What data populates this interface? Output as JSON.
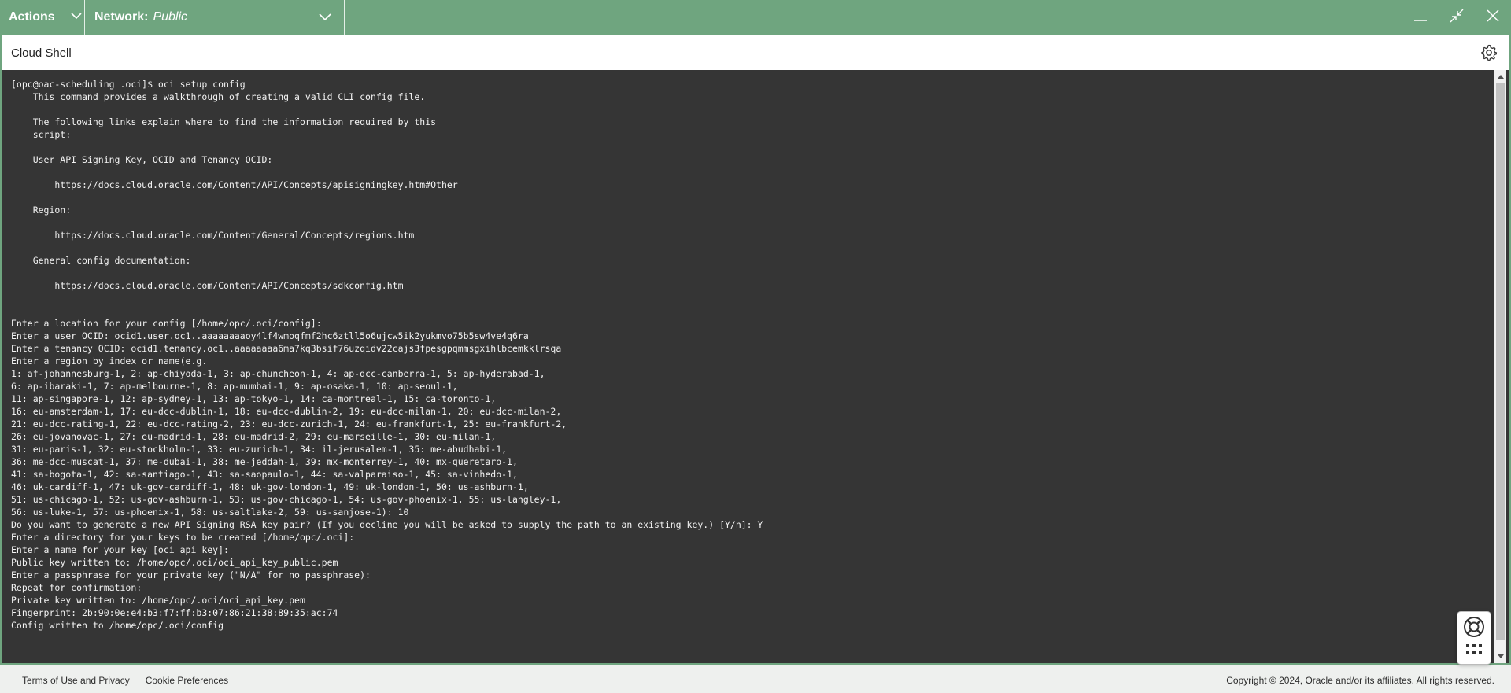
{
  "topbar": {
    "actions_label": "Actions",
    "network_label": "Network:",
    "network_value": "Public",
    "color": "#6fa57f"
  },
  "header": {
    "title": "Cloud Shell"
  },
  "terminal": {
    "background": "#353535",
    "lines": [
      "[opc@oac-scheduling .oci]$ oci setup config",
      "    This command provides a walkthrough of creating a valid CLI config file.",
      "",
      "    The following links explain where to find the information required by this",
      "    script:",
      "",
      "    User API Signing Key, OCID and Tenancy OCID:",
      "",
      "        https://docs.cloud.oracle.com/Content/API/Concepts/apisigningkey.htm#Other",
      "",
      "    Region:",
      "",
      "        https://docs.cloud.oracle.com/Content/General/Concepts/regions.htm",
      "",
      "    General config documentation:",
      "",
      "        https://docs.cloud.oracle.com/Content/API/Concepts/sdkconfig.htm",
      "",
      "",
      "Enter a location for your config [/home/opc/.oci/config]:",
      "Enter a user OCID: ocid1.user.oc1..aaaaaaaaoy4lf4wmoqfmf2hc6ztll5o6ujcw5ik2yukmvo75b5sw4ve4q6ra",
      "Enter a tenancy OCID: ocid1.tenancy.oc1..aaaaaaaa6ma7kq3bsif76uzqidv22cajs3fpesgpqmmsgxihlbcemkklrsqa",
      "Enter a region by index or name(e.g.",
      "1: af-johannesburg-1, 2: ap-chiyoda-1, 3: ap-chuncheon-1, 4: ap-dcc-canberra-1, 5: ap-hyderabad-1,",
      "6: ap-ibaraki-1, 7: ap-melbourne-1, 8: ap-mumbai-1, 9: ap-osaka-1, 10: ap-seoul-1,",
      "11: ap-singapore-1, 12: ap-sydney-1, 13: ap-tokyo-1, 14: ca-montreal-1, 15: ca-toronto-1,",
      "16: eu-amsterdam-1, 17: eu-dcc-dublin-1, 18: eu-dcc-dublin-2, 19: eu-dcc-milan-1, 20: eu-dcc-milan-2,",
      "21: eu-dcc-rating-1, 22: eu-dcc-rating-2, 23: eu-dcc-zurich-1, 24: eu-frankfurt-1, 25: eu-frankfurt-2,",
      "26: eu-jovanovac-1, 27: eu-madrid-1, 28: eu-madrid-2, 29: eu-marseille-1, 30: eu-milan-1,",
      "31: eu-paris-1, 32: eu-stockholm-1, 33: eu-zurich-1, 34: il-jerusalem-1, 35: me-abudhabi-1,",
      "36: me-dcc-muscat-1, 37: me-dubai-1, 38: me-jeddah-1, 39: mx-monterrey-1, 40: mx-queretaro-1,",
      "41: sa-bogota-1, 42: sa-santiago-1, 43: sa-saopaulo-1, 44: sa-valparaiso-1, 45: sa-vinhedo-1,",
      "46: uk-cardiff-1, 47: uk-gov-cardiff-1, 48: uk-gov-london-1, 49: uk-london-1, 50: us-ashburn-1,",
      "51: us-chicago-1, 52: us-gov-ashburn-1, 53: us-gov-chicago-1, 54: us-gov-phoenix-1, 55: us-langley-1,",
      "56: us-luke-1, 57: us-phoenix-1, 58: us-saltlake-2, 59: us-sanjose-1): 10",
      "Do you want to generate a new API Signing RSA key pair? (If you decline you will be asked to supply the path to an existing key.) [Y/n]: Y",
      "Enter a directory for your keys to be created [/home/opc/.oci]:",
      "Enter a name for your key [oci_api_key]:",
      "Public key written to: /home/opc/.oci/oci_api_key_public.pem",
      "Enter a passphrase for your private key (\"N/A\" for no passphrase):",
      "Repeat for confirmation:",
      "Private key written to: /home/opc/.oci/oci_api_key.pem",
      "Fingerprint: 2b:90:0e:e4:b3:f7:ff:b3:07:86:21:38:89:35:ac:74",
      "Config written to /home/opc/.oci/config"
    ]
  },
  "icons": {
    "actions_chevron": "chevron-down-icon",
    "network_chevron": "chevron-down-icon",
    "minimize": "minimize-icon",
    "restore": "restore-icon",
    "close": "close-icon",
    "settings": "gear-icon",
    "help": "lifebuoy-icon",
    "apps": "grid-icon"
  },
  "footer": {
    "terms_label": "Terms of Use and Privacy",
    "cookie_label": "Cookie Preferences",
    "copyright": "Copyright © 2024, Oracle and/or its affiliates. All rights reserved."
  }
}
